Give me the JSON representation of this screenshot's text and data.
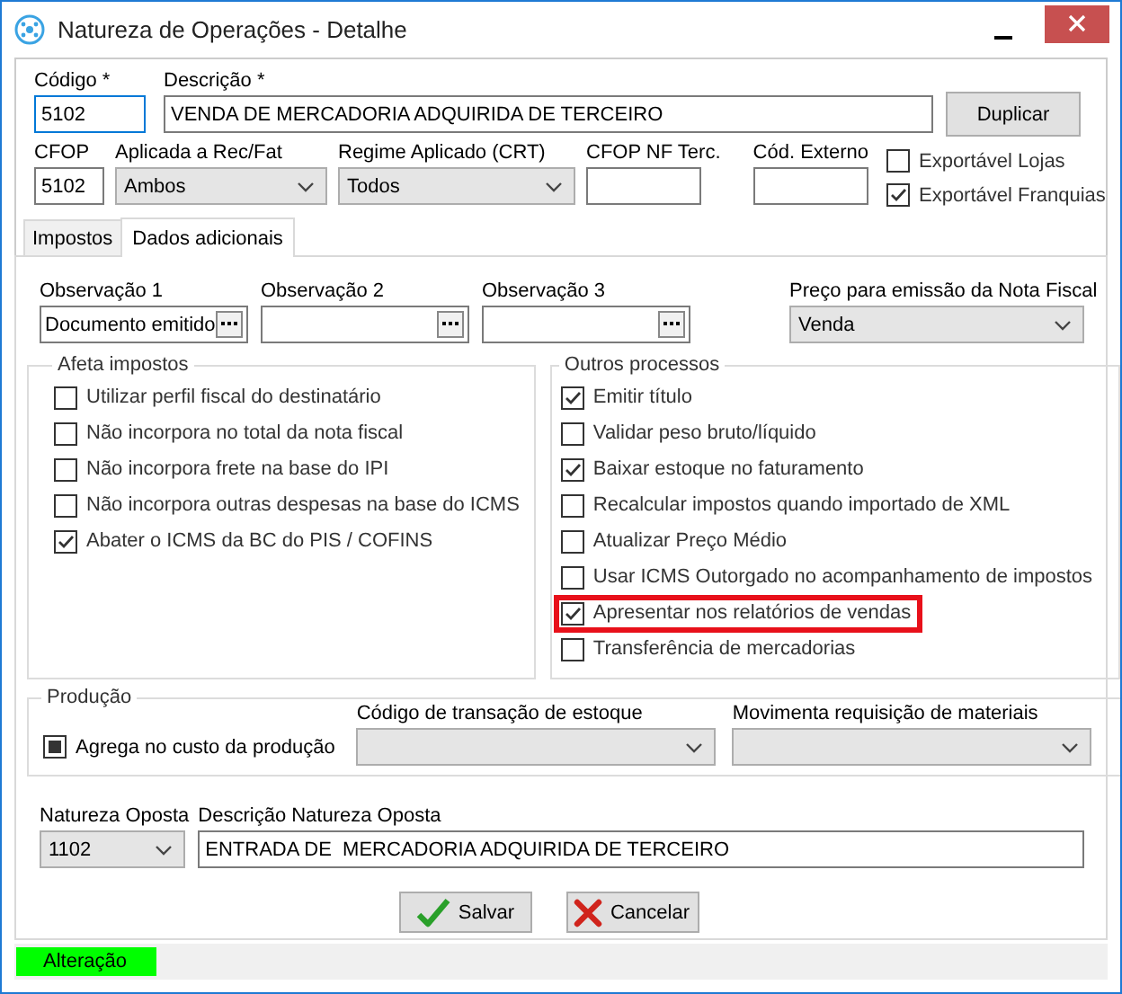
{
  "window": {
    "title": "Natureza de Operações - Detalhe"
  },
  "header": {
    "codigo": {
      "label": "Código *",
      "value": "5102"
    },
    "descricao": {
      "label": "Descrição *",
      "value": "VENDA DE MERCADORIA ADQUIRIDA DE TERCEIRO"
    },
    "duplicate_button": "Duplicar",
    "cfop": {
      "label": "CFOP",
      "value": "5102"
    },
    "aplicada": {
      "label": "Aplicada a Rec/Fat",
      "value": "Ambos"
    },
    "regime": {
      "label": "Regime Aplicado (CRT)",
      "value": "Todos"
    },
    "cfop_nf": {
      "label": "CFOP NF Terc."
    },
    "cod_externo": {
      "label": "Cód. Externo"
    },
    "export_options": [
      {
        "label": "Exportável Lojas",
        "checked": false
      },
      {
        "label": "Exportável Franquias",
        "checked": true
      }
    ]
  },
  "tabs": [
    {
      "label": "Impostos",
      "selected": false
    },
    {
      "label": "Dados adicionais",
      "selected": true
    }
  ],
  "observacoes": [
    {
      "label": "Observação 1",
      "value": "Documento emitido"
    },
    {
      "label": "Observação 2"
    },
    {
      "label": "Observação 3"
    }
  ],
  "preco": {
    "label": "Preço para emissão da Nota Fiscal",
    "value": "Venda"
  },
  "afeta_impostos": {
    "title": "Afeta impostos",
    "items": [
      {
        "label": "Utilizar perfil fiscal do destinatário",
        "checked": false
      },
      {
        "label": "Não incorpora no total da nota fiscal",
        "checked": false
      },
      {
        "label": "Não incorpora frete na base do IPI",
        "checked": false
      },
      {
        "label": "Não incorpora outras despesas na base do ICMS",
        "checked": false
      },
      {
        "label": "Abater o ICMS da BC do PIS / COFINS",
        "checked": true
      }
    ]
  },
  "outros_processos": {
    "title": "Outros processos",
    "items": [
      {
        "label": "Emitir título",
        "checked": true,
        "highlighted": false
      },
      {
        "label": "Validar peso bruto/líquido",
        "checked": false,
        "highlighted": false
      },
      {
        "label": "Baixar estoque no faturamento",
        "checked": true,
        "highlighted": false
      },
      {
        "label": "Recalcular impostos quando importado de XML",
        "checked": false,
        "highlighted": false
      },
      {
        "label": "Atualizar Preço Médio",
        "checked": false,
        "highlighted": false
      },
      {
        "label": "Usar ICMS Outorgado no acompanhamento de impostos",
        "checked": false,
        "highlighted": false
      },
      {
        "label": "Apresentar nos relatórios de vendas",
        "checked": true,
        "highlighted": true
      },
      {
        "label": "Transferência de mercadorias",
        "checked": false,
        "highlighted": false
      }
    ]
  },
  "producao": {
    "title": "Produção",
    "agrega": {
      "label": "Agrega no custo da produção",
      "checked": false,
      "indeterminate": true
    },
    "codigo_transacao": {
      "label": "Código de transação de estoque"
    },
    "movimenta": {
      "label": "Movimenta requisição de materiais"
    }
  },
  "natureza_oposta": {
    "label": "Natureza Oposta",
    "value": "1102"
  },
  "descricao_oposta": {
    "label": "Descrição Natureza Oposta",
    "value": "ENTRADA DE  MERCADORIA ADQUIRIDA DE TERCEIRO"
  },
  "buttons": [
    {
      "kind": "save",
      "label": "Salvar"
    },
    {
      "kind": "cancel",
      "label": "Cancelar"
    }
  ],
  "status_bar": {
    "text": "Alteração"
  }
}
